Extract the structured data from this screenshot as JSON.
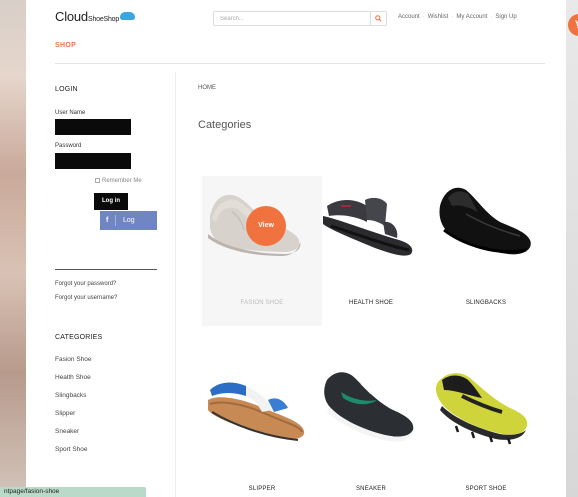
{
  "header": {
    "logo_main": "Cloud",
    "logo_sub": "ShoeShop",
    "search_placeholder": "Search...",
    "search_icon": "search-icon",
    "links": [
      "Account",
      "Wishlist",
      "My Account",
      "Sign Up"
    ],
    "cart_icon": "cart-icon",
    "nav_label": "SHOP"
  },
  "colors": {
    "accent": "#f0733f",
    "facebook": "#6f86c2",
    "field": "#0a0a0a"
  },
  "sidebar": {
    "login_title": "LOGIN",
    "username_label": "User Name",
    "username_value": "",
    "password_label": "Password",
    "password_value": "",
    "remember_label": "Remember Me",
    "login_button": "Log in",
    "facebook_icon": "f",
    "facebook_button": "Log",
    "forgot_password": "Forgot your password?",
    "forgot_username": "Forgot your username?",
    "categories_title": "CATEGORIES",
    "categories": [
      "Fasion Shoe",
      "Health Shoe",
      "Slingbacks",
      "Slipper",
      "Sneaker",
      "Sport Shoe"
    ]
  },
  "main": {
    "breadcrumb": "HOME",
    "heading": "Categories",
    "view_label": "View",
    "products": [
      {
        "name": "FASION SHOE",
        "icon": "dress-shoe-beige"
      },
      {
        "name": "HEALTH SHOE",
        "icon": "sandal-black"
      },
      {
        "name": "SLINGBACKS",
        "icon": "loafer-black"
      },
      {
        "name": "SLIPPER",
        "icon": "flipflop-blue"
      },
      {
        "name": "SNEAKER",
        "icon": "sneaker-black"
      },
      {
        "name": "SPORT SHOE",
        "icon": "football-boot-yellow"
      }
    ]
  },
  "status_bar": {
    "url": "ntpage/fasion-shoe"
  }
}
